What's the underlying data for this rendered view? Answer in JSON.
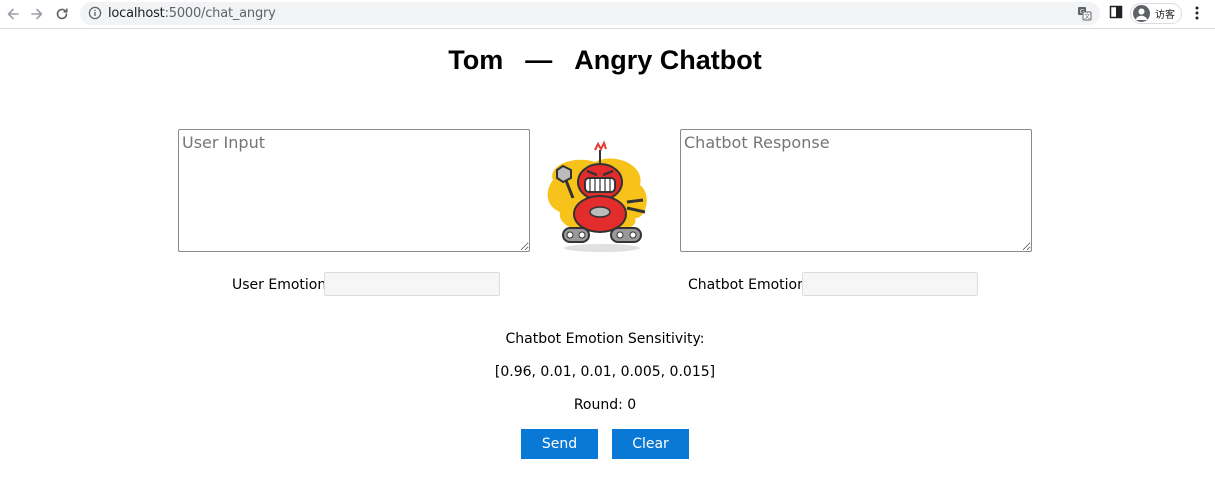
{
  "browser": {
    "url_host": "localhost",
    "url_rest": ":5000/chat_angry",
    "profile_label": "访客"
  },
  "page": {
    "title_name": "Tom",
    "title_dash": "—",
    "title_rest": "Angry Chatbot"
  },
  "user_input": {
    "placeholder": "User Input",
    "value": ""
  },
  "bot_response": {
    "placeholder": "Chatbot Response",
    "value": ""
  },
  "user_emotion": {
    "label": "User Emotion:",
    "value": ""
  },
  "bot_emotion": {
    "label": "Chatbot Emotion:",
    "value": ""
  },
  "sensitivity": {
    "label": "Chatbot Emotion Sensitivity:",
    "values": "[0.96, 0.01, 0.01, 0.005, 0.015]"
  },
  "round_text": "Round: 0",
  "buttons": {
    "send": "Send",
    "clear": "Clear"
  },
  "colors": {
    "button": "#0a79d6",
    "title": "#000000"
  },
  "icons": {
    "back": "back-arrow-icon",
    "forward": "forward-arrow-icon",
    "reload": "reload-icon",
    "info": "info-icon",
    "translate": "translate-icon",
    "sidepanel": "side-panel-icon",
    "profile": "profile-avatar-icon",
    "menu": "kebab-menu-icon",
    "robot": "angry-robot-image"
  }
}
